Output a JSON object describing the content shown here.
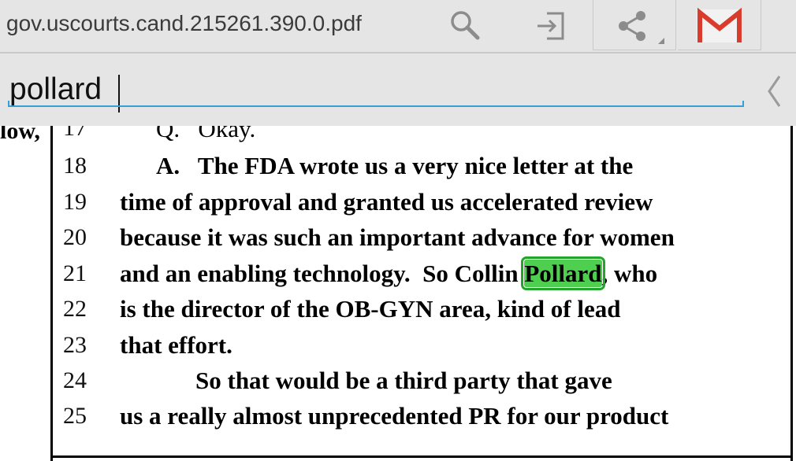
{
  "toolbar": {
    "filename": "gov.uscourts.cand.215261.390.0.pdf",
    "icons": [
      "search-icon",
      "export-icon",
      "share-icon",
      "gmail-icon"
    ]
  },
  "find": {
    "query": "pollard"
  },
  "document": {
    "left_fragment": "low,",
    "lines": [
      {
        "num": "17",
        "text": "Q.   Okay."
      },
      {
        "num": "18",
        "text": "A.   The FDA wrote us a very nice letter at the"
      },
      {
        "num": "19",
        "text": "time of approval and granted us accelerated review"
      },
      {
        "num": "20",
        "text": "because it was such an important advance for women"
      },
      {
        "num": "21",
        "text_before": "and an enabling technology.  So Collin ",
        "match": "Pollard",
        "text_after": ", who"
      },
      {
        "num": "22",
        "text": "is the director of the OB-GYN area, kind of lead"
      },
      {
        "num": "23",
        "text": "that effort."
      },
      {
        "num": "24",
        "text": "So that would be a third party that gave"
      },
      {
        "num": "25",
        "text": "us a really almost unprecedented PR for our product"
      }
    ]
  },
  "colors": {
    "highlight": "#4fcf4f",
    "highlight_border": "#22a52a",
    "underline": "#35a0d6",
    "gmail_red": "#d93c2c"
  }
}
